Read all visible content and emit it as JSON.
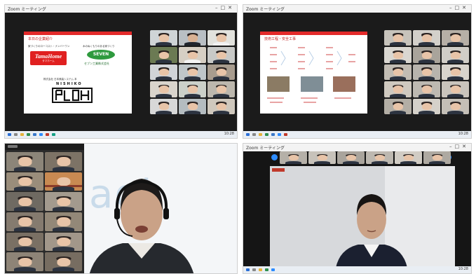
{
  "windows": {
    "top_left": {
      "title": "Zoom ミーティング"
    },
    "top_right": {
      "title": "Zoom ミーティング"
    },
    "bottom_right": {
      "title": "Zoom ミーティング"
    }
  },
  "slide1": {
    "heading": "本日の企業紹介",
    "col1_caption": "家づくりのローコスト・ナンバーワン",
    "col2_caption": "木のぬくもりのある家づくり",
    "brand1": "TamaHome",
    "brand1_sub": "タマホーム",
    "brand2": "SEVEN",
    "brand2_sub": "セブン工業株式会社",
    "brand3_caption": "株式会社 日本美装システム 本",
    "brand3": "NISHIKO"
  },
  "slide2": {
    "heading": "技術工程・安全工事"
  },
  "background_logo": "agi",
  "taskbar": {
    "clock": "10:28"
  },
  "colors": {
    "zoom_dark": "#1b1b1b",
    "slide_red": "#e32a2a",
    "tama_red": "#e02020",
    "seven_green": "#2e9a3e",
    "zoom_blue": "#2d8cff"
  }
}
